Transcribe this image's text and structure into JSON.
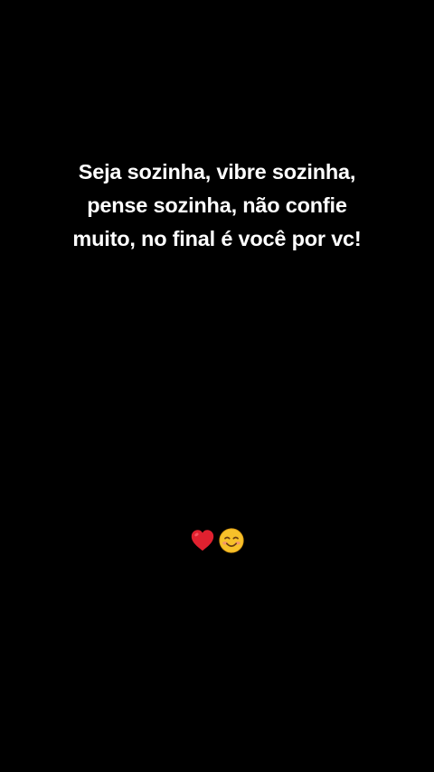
{
  "background_color": "#000000",
  "caption": {
    "lines": [
      "Seja sozinha, vibre sozinha,",
      "pense sozinha, não confie",
      "muito, no final é você por vc!"
    ],
    "color": "#ffffff"
  },
  "emojis": [
    {
      "icon": "red-heart-icon",
      "color": "#e0212f"
    },
    {
      "icon": "smiling-face-icon",
      "color": "#f7c12a"
    }
  ]
}
